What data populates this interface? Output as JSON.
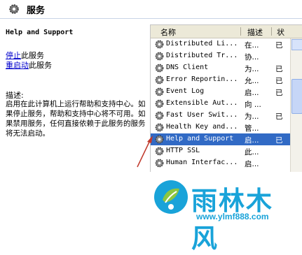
{
  "header": {
    "title": "服务",
    "icon": "gear-icon"
  },
  "left_panel": {
    "service_name": "Help and Support",
    "actions": [
      {
        "link": "停止",
        "suffix": "此服务"
      },
      {
        "link": "重启动",
        "suffix": "此服务"
      }
    ],
    "description_label": "描述:",
    "description_text": "启用在此计算机上运行帮助和支持中心。如果停止服务，帮助和支持中心将不可用。如果禁用服务，任何直接依赖于此服务的服务将无法启动。"
  },
  "list": {
    "columns": [
      "名称",
      "描述",
      "状"
    ],
    "rows": [
      {
        "name": "Distributed Li...",
        "desc": "在...",
        "status": "已"
      },
      {
        "name": "Distributed Tr...",
        "desc": "协...",
        "status": ""
      },
      {
        "name": "DNS Client",
        "desc": "为...",
        "status": "已"
      },
      {
        "name": "Error Reportin...",
        "desc": "允...",
        "status": "已"
      },
      {
        "name": "Event Log",
        "desc": "启...",
        "status": "已"
      },
      {
        "name": "Extensible Aut...",
        "desc": "向 ...",
        "status": ""
      },
      {
        "name": "Fast User Swit...",
        "desc": "为...",
        "status": "已"
      },
      {
        "name": "Health Key and...",
        "desc": "管...",
        "status": ""
      },
      {
        "name": "Help and Support",
        "desc": "启...",
        "status": "已",
        "selected": true
      },
      {
        "name": "HTTP SSL",
        "desc": "此...",
        "status": ""
      },
      {
        "name": "Human Interfac...",
        "desc": "启...",
        "status": ""
      }
    ]
  },
  "watermark": {
    "brand": "雨林木风",
    "url": "www.ylmf888.com",
    "color": "#19a3d9"
  },
  "colors": {
    "selection": "#316ac5",
    "link": "#0000cc",
    "arrow": "#c0392b"
  }
}
